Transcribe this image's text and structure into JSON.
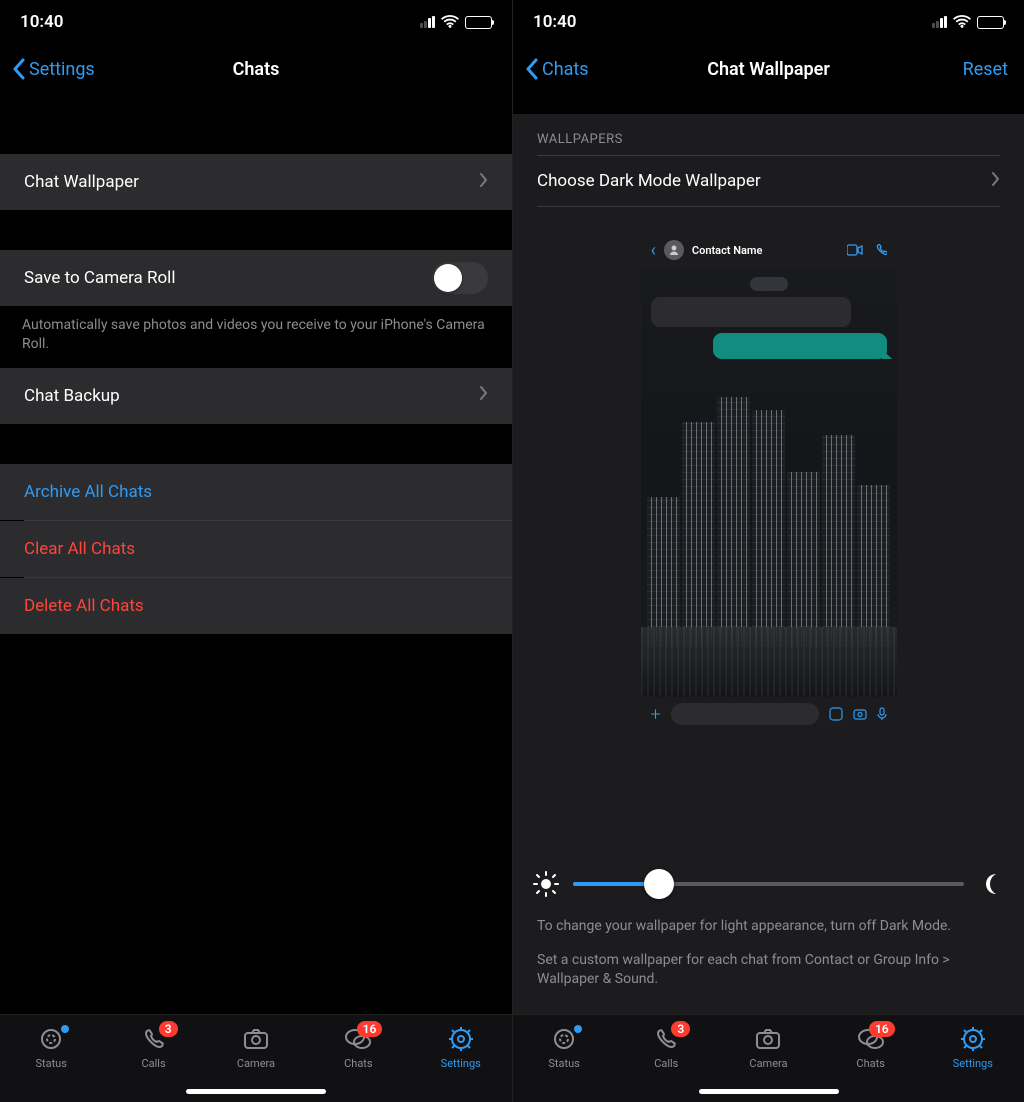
{
  "status": {
    "time": "10:40"
  },
  "left": {
    "nav_back": "Settings",
    "title": "Chats",
    "rows": {
      "wallpaper": "Chat Wallpaper",
      "save_camera": "Save to Camera Roll",
      "save_desc": "Automatically save photos and videos you receive to your iPhone's Camera Roll.",
      "backup": "Chat Backup",
      "archive": "Archive All Chats",
      "clear": "Clear All Chats",
      "delete": "Delete All Chats"
    }
  },
  "right": {
    "nav_back": "Chats",
    "title": "Chat Wallpaper",
    "reset": "Reset",
    "section_head": "WALLPAPERS",
    "choose": "Choose Dark Mode Wallpaper",
    "preview_contact": "Contact Name",
    "desc1": "To change your wallpaper for light appearance, turn off Dark Mode.",
    "desc2": "Set a custom wallpaper for each chat from Contact or Group Info > Wallpaper & Sound."
  },
  "tabs": {
    "status": "Status",
    "calls": "Calls",
    "camera": "Camera",
    "chats": "Chats",
    "settings": "Settings",
    "badge_calls": "3",
    "badge_chats": "16"
  }
}
